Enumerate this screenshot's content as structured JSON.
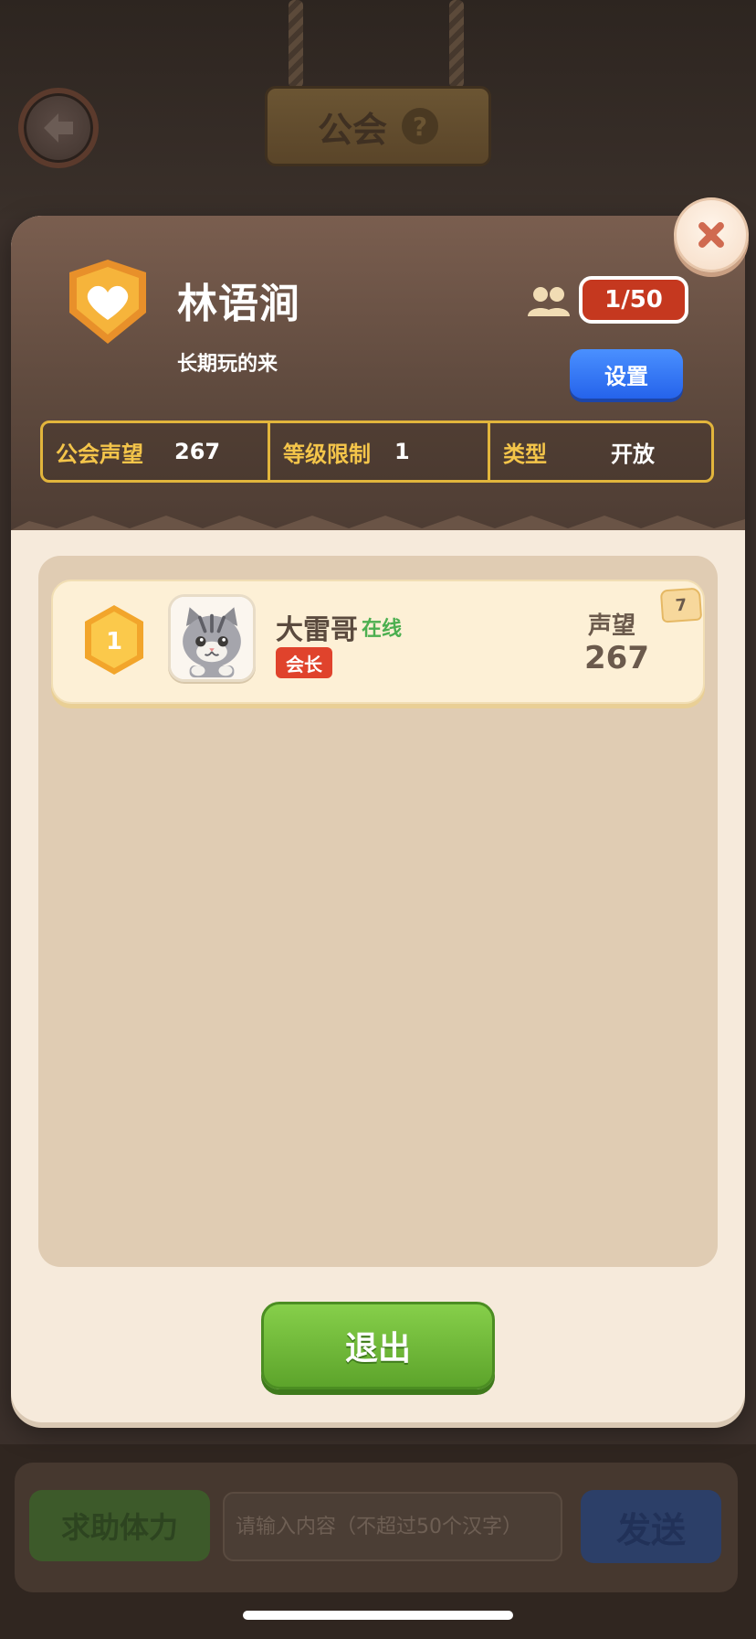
{
  "background": {
    "page_title": "公会",
    "help_glyph": "?",
    "back_icon": "arrow-left-icon"
  },
  "guild": {
    "name": "林语涧",
    "motto": "长期玩的来",
    "member_count": "1/50",
    "settings_label": "设置",
    "stats": [
      {
        "label": "公会声望",
        "value": "267"
      },
      {
        "label": "等级限制",
        "value": "1"
      },
      {
        "label": "类型",
        "value": "开放"
      }
    ]
  },
  "members": [
    {
      "rank": "1",
      "name": "大雷哥",
      "status": "在线",
      "role": "会长",
      "rep_label": "声望",
      "reputation": "267",
      "level": "7"
    }
  ],
  "exit_label": "退出",
  "chat": {
    "help_label": "求助体力",
    "placeholder": "请输入内容（不超过50个汉字）",
    "send_label": "发送"
  },
  "colors": {
    "accent_gold": "#e2b53c",
    "member_count_red": "#c5381f",
    "settings_blue": "#2563eb",
    "exit_green": "#5da42b",
    "online_green": "#4caf50"
  }
}
